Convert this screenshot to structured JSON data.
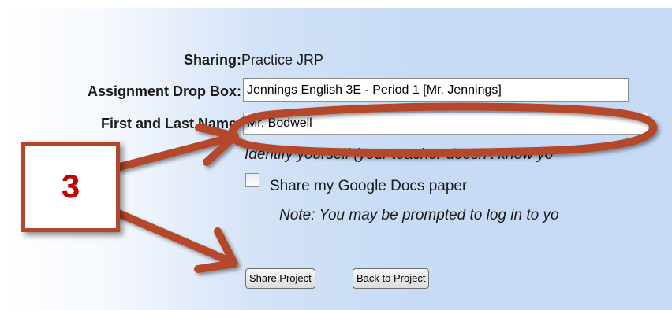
{
  "form": {
    "sharing_label": "Sharing:",
    "sharing_value": "Practice JRP",
    "dropbox_label": "Assignment Drop Box:",
    "dropbox_value": "Jennings English 3E - Period 1 [Mr. Jennings]",
    "name_label": "First and Last Name:",
    "name_value": "Mr. Bodwell",
    "name_hint": "Identify yourself (your teacher doesn't know yo",
    "google_docs_label": "Share my Google Docs paper",
    "google_docs_note": "Note: You may be prompted to log in to yo"
  },
  "buttons": {
    "share": "Share Project",
    "back": "Back to Project"
  },
  "callout": {
    "number": "3",
    "color": "#b5462c",
    "number_color": "#c10000"
  },
  "icons": [
    "checkbox-icon",
    "arrow-icon"
  ]
}
